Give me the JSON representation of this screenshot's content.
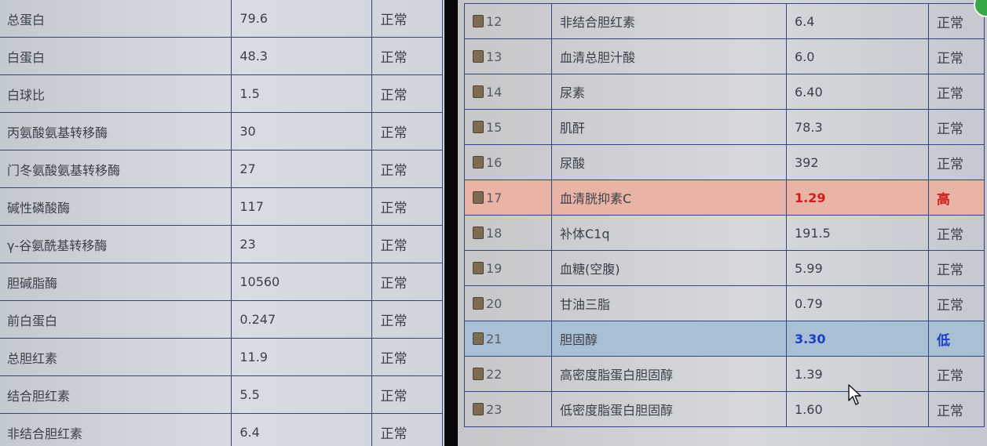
{
  "left_rows": [
    {
      "name": "总蛋白",
      "value": "79.6",
      "status": "正常"
    },
    {
      "name": "白蛋白",
      "value": "48.3",
      "status": "正常"
    },
    {
      "name": "白球比",
      "value": "1.5",
      "status": "正常"
    },
    {
      "name": "丙氨酸氨基转移酶",
      "value": "30",
      "status": "正常"
    },
    {
      "name": "门冬氨酸氨基转移酶",
      "value": "27",
      "status": "正常"
    },
    {
      "name": "碱性磷酸酶",
      "value": "117",
      "status": "正常"
    },
    {
      "name": "γ-谷氨酰基转移酶",
      "value": "23",
      "status": "正常"
    },
    {
      "name": "胆碱脂酶",
      "value": "10560",
      "status": "正常"
    },
    {
      "name": "前白蛋白",
      "value": "0.247",
      "status": "正常"
    },
    {
      "name": "总胆红素",
      "value": "11.9",
      "status": "正常"
    },
    {
      "name": "结合胆红素",
      "value": "5.5",
      "status": "正常"
    },
    {
      "name": "非结合胆红素",
      "value": "6.4",
      "status": "正常"
    }
  ],
  "right_rows": [
    {
      "no": "12",
      "name": "非结合胆红素",
      "value": "6.4",
      "status": "正常",
      "flag": "normal"
    },
    {
      "no": "13",
      "name": "血清总胆汁酸",
      "value": "6.0",
      "status": "正常",
      "flag": "normal"
    },
    {
      "no": "14",
      "name": "尿素",
      "value": "6.40",
      "status": "正常",
      "flag": "normal"
    },
    {
      "no": "15",
      "name": "肌酐",
      "value": "78.3",
      "status": "正常",
      "flag": "normal"
    },
    {
      "no": "16",
      "name": "尿酸",
      "value": "392",
      "status": "正常",
      "flag": "normal"
    },
    {
      "no": "17",
      "name": "血清胱抑素C",
      "value": "1.29",
      "status": "高",
      "flag": "high"
    },
    {
      "no": "18",
      "name": "补体C1q",
      "value": "191.5",
      "status": "正常",
      "flag": "normal"
    },
    {
      "no": "19",
      "name": "血糖(空腹)",
      "value": "5.99",
      "status": "正常",
      "flag": "normal"
    },
    {
      "no": "20",
      "name": "甘油三脂",
      "value": "0.79",
      "status": "正常",
      "flag": "normal"
    },
    {
      "no": "21",
      "name": "胆固醇",
      "value": "3.30",
      "status": "低",
      "flag": "low"
    },
    {
      "no": "22",
      "name": "高密度脂蛋白胆固醇",
      "value": "1.39",
      "status": "正常",
      "flag": "normal"
    },
    {
      "no": "23",
      "name": "低密度脂蛋白胆固醇",
      "value": "1.60",
      "status": "正常",
      "flag": "normal"
    }
  ],
  "colors": {
    "high_row": "#e9b3a6",
    "high_text": "#d21b1b",
    "low_row": "#a9bfd3",
    "low_text": "#1a3fc4",
    "grid": "#2f4683"
  },
  "icons": {
    "row_checkbox": "checkbox-icon",
    "cursor": "mouse-cursor-icon",
    "corner": "status-badge-icon"
  }
}
